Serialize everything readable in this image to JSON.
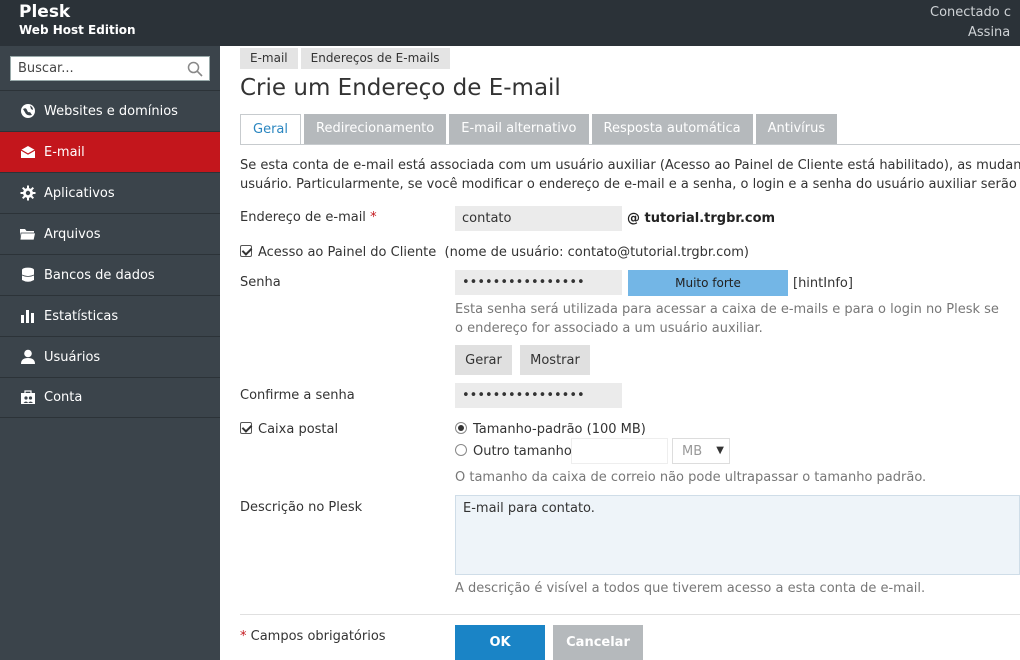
{
  "header": {
    "brand_name": "Plesk",
    "brand_edition": "Web Host Edition",
    "connected_text": "Conectado c",
    "signature_text": "Assina"
  },
  "sidebar": {
    "search_placeholder": "Buscar...",
    "items": [
      {
        "label": "Websites e domínios",
        "icon": "globe-icon"
      },
      {
        "label": "E-mail",
        "icon": "envelope-icon",
        "active": true
      },
      {
        "label": "Aplicativos",
        "icon": "gear-icon"
      },
      {
        "label": "Arquivos",
        "icon": "folder-icon"
      },
      {
        "label": "Bancos de dados",
        "icon": "database-icon"
      },
      {
        "label": "Estatísticas",
        "icon": "bar-chart-icon"
      },
      {
        "label": "Usuários",
        "icon": "user-icon"
      },
      {
        "label": "Conta",
        "icon": "account-icon"
      }
    ],
    "accent_color": "#c3161c"
  },
  "breadcrumb": [
    "E-mail",
    "Endereços de E-mails"
  ],
  "page_title": "Crie um Endereço de E-mail",
  "tabs": [
    {
      "label": "Geral",
      "active": true
    },
    {
      "label": "Redirecionamento"
    },
    {
      "label": "E-mail alternativo"
    },
    {
      "label": "Resposta automática"
    },
    {
      "label": "Antivírus"
    }
  ],
  "intro": {
    "line1": "Se esta conta de e-mail está associada com um usuário auxiliar (Acesso ao Painel de Cliente está habilitado), as mudanças feitas n",
    "line2": "usuário. Particularmente, se você modificar o endereço de e-mail e a senha, o login e a senha do usuário auxiliar serão modificad"
  },
  "form": {
    "email_label": "Endereço de e-mail",
    "required_mark": "*",
    "email_value": "contato",
    "email_domain": "@ tutorial.trgbr.com",
    "panel_access_label": "Acesso ao Painel do Cliente",
    "panel_access_user": "(nome de usuário: contato@tutorial.trgbr.com)",
    "password_label": "Senha",
    "password_value": "••••••••••••••••",
    "strength_label": "Muito forte",
    "hint_info": "[hintInfo]",
    "password_hint_line1": "Esta senha será utilizada para acessar a caixa de e-mails e para o login no Plesk se",
    "password_hint_line2": "o endereço for associado a um usuário auxiliar.",
    "generate_button": "Gerar",
    "show_button": "Mostrar",
    "confirm_label": "Confirme a senha",
    "confirm_value": "••••••••••••••••",
    "mailbox_label": "Caixa postal",
    "size_default_label": "Tamanho-padrão (100 MB)",
    "size_other_label": "Outro tamanho",
    "size_unit": "MB",
    "mailbox_hint": "O tamanho da caixa de correio não pode ultrapassar o tamanho padrão.",
    "description_label": "Descrição no Plesk",
    "description_value": "E-mail para contato.",
    "description_hint": "A descrição é visível a todos que tiverem acesso a esta conta de e-mail.",
    "required_note": "Campos obrigatórios",
    "ok_button": "OK",
    "cancel_button": "Cancelar"
  }
}
